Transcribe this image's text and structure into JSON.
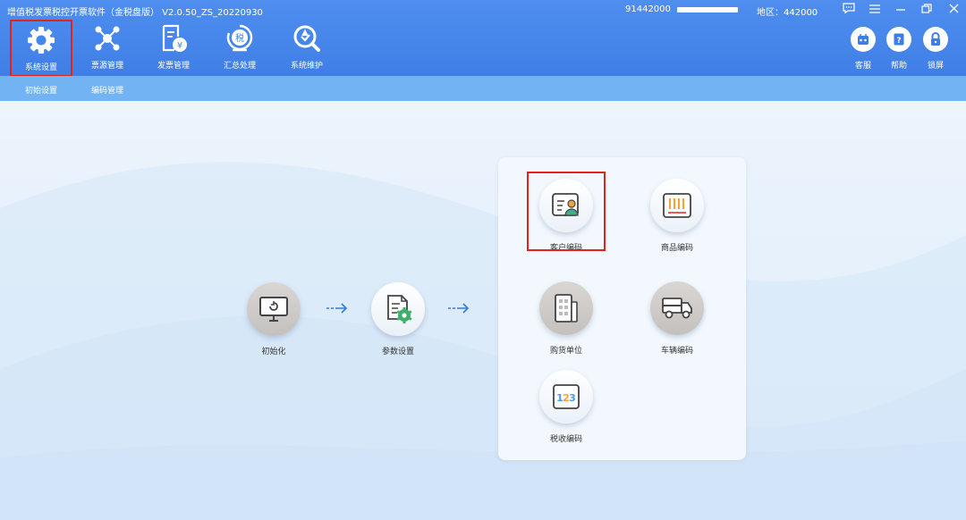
{
  "app": {
    "title": "增值税发票税控开票软件（金税盘版） V2.0.50_ZS_20220930",
    "tax_no": "91442000",
    "region": "地区：442000"
  },
  "window_controls": [
    "message-icon",
    "menu-icon",
    "minimize-icon",
    "restore-icon",
    "close-icon"
  ],
  "menu": [
    {
      "label": "系统设置",
      "icon": "gear-icon",
      "active": true
    },
    {
      "label": "票源管理",
      "icon": "network-icon"
    },
    {
      "label": "发票管理",
      "icon": "invoice-icon"
    },
    {
      "label": "汇总处理",
      "icon": "tax-summary-icon"
    },
    {
      "label": "系统维护",
      "icon": "maintenance-icon"
    }
  ],
  "right_buttons": [
    {
      "label": "客服",
      "icon": "robot-icon"
    },
    {
      "label": "帮助",
      "icon": "help-icon"
    },
    {
      "label": "锁屏",
      "icon": "lock-icon"
    }
  ],
  "subtabs": [
    "初始设置",
    "编码管理"
  ],
  "flow": [
    {
      "label": "初始化",
      "icon": "monitor-icon"
    },
    {
      "label": "参数设置",
      "icon": "document-settings-icon"
    }
  ],
  "codes": [
    {
      "label": "客户编码",
      "icon": "customer-card-icon",
      "highlighted": true
    },
    {
      "label": "商品编码",
      "icon": "barcode-icon"
    },
    {
      "label": "购货单位",
      "icon": "building-icon"
    },
    {
      "label": "车辆编码",
      "icon": "truck-icon"
    },
    {
      "label": "税收编码",
      "icon": "number-123-icon",
      "icon_text": "123"
    }
  ],
  "colors": {
    "topbar": "#4286ec",
    "subnav": "#72b3f3",
    "highlight": "#e2231a",
    "arrow": "#3a78d9"
  }
}
